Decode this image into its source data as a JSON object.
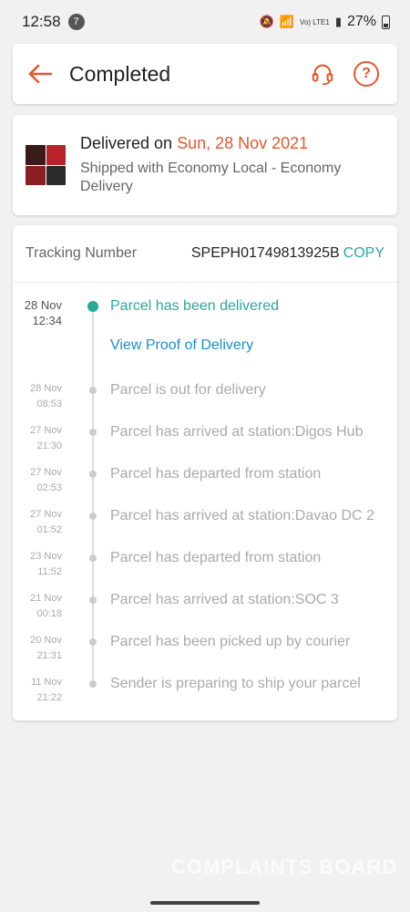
{
  "status_bar": {
    "time": "12:58",
    "notification_count": "7",
    "network": "Vo) LTE1",
    "battery": "27%"
  },
  "header": {
    "title": "Completed",
    "back_icon": "arrow-left-icon",
    "support_icon": "headset-icon",
    "help_icon": "question-icon",
    "help_glyph": "?",
    "accent": "#e4572e"
  },
  "delivery": {
    "prefix": "Delivered on ",
    "date": "Sun, 28 Nov 2021",
    "shipping": "Shipped with Economy Local - Economy Delivery"
  },
  "tracking": {
    "label": "Tracking Number",
    "number": "SPEPH01749813925B",
    "copy_label": "COPY",
    "events": [
      {
        "date": "28 Nov",
        "time": "12:34",
        "desc": "Parcel has been delivered",
        "link": "View Proof of Delivery"
      },
      {
        "date": "28 Nov",
        "time": "08:53",
        "desc": "Parcel is out for delivery"
      },
      {
        "date": "27 Nov",
        "time": "21:30",
        "desc": "Parcel has arrived at station:Digos Hub"
      },
      {
        "date": "27 Nov",
        "time": "02:53",
        "desc": "Parcel has departed from station"
      },
      {
        "date": "27 Nov",
        "time": "01:52",
        "desc": "Parcel has arrived at station:Davao DC 2"
      },
      {
        "date": "23 Nov",
        "time": "11:52",
        "desc": "Parcel has departed from station"
      },
      {
        "date": "21 Nov",
        "time": "00:18",
        "desc": "Parcel has arrived at station:SOC 3"
      },
      {
        "date": "20 Nov",
        "time": "21:31",
        "desc": "Parcel has been picked up by courier"
      },
      {
        "date": "11 Nov",
        "time": "21:22",
        "desc": "Sender is preparing to ship your parcel"
      }
    ]
  },
  "watermark": "COMPLAINTS BOARD"
}
